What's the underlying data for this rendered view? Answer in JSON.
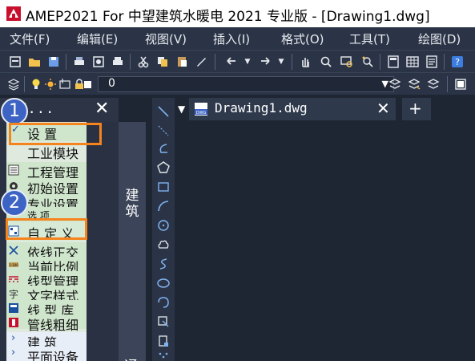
{
  "window": {
    "title": "AMEP2021 For 中望建筑水暖电 2021 专业版 - [Drawing1.dwg]"
  },
  "menubar": {
    "items": [
      "文件(F)",
      "编辑(E)",
      "视图(V)",
      "插入(I)",
      "格式(O)",
      "工具(T)",
      "绘图(D)"
    ]
  },
  "layer_toolbar": {
    "current_layer": "0"
  },
  "panel": {
    "title": "ME...",
    "close_label": "✕",
    "items": [
      {
        "label": "设    置",
        "type": "expanded"
      },
      {
        "label": "工业模块",
        "type": "item"
      },
      {
        "label": "工程管理",
        "type": "item"
      },
      {
        "label": "初始设置",
        "type": "item"
      },
      {
        "label": "专业设置",
        "type": "item"
      },
      {
        "label": "选    项",
        "type": "item"
      },
      {
        "label": "自 定 义",
        "type": "item"
      },
      {
        "label": "依线正交",
        "type": "item"
      },
      {
        "label": "当前比例",
        "type": "item"
      },
      {
        "label": "线型管理",
        "type": "item"
      },
      {
        "label": "文字样式",
        "type": "item"
      },
      {
        "label": "线 型 库",
        "type": "item"
      },
      {
        "label": "管线粗细",
        "type": "item"
      },
      {
        "label": "建    筑",
        "type": "collapsed"
      },
      {
        "label": "平面设备",
        "type": "collapsed"
      }
    ],
    "vertical_tab_label": "建筑",
    "vertical_tab_label_2": "通"
  },
  "document": {
    "tab_name": "Drawing1.dwg",
    "close_label": "✕",
    "new_tab_label": "+"
  },
  "annotations": {
    "badge_1": "1",
    "badge_2": "2"
  },
  "colors": {
    "menu_bg": "#2b3446",
    "canvas_bg": "#1f2633",
    "panel_list_bg": "#dfe9dd",
    "highlight": "#f5841f",
    "badge": "#3d63c4"
  }
}
